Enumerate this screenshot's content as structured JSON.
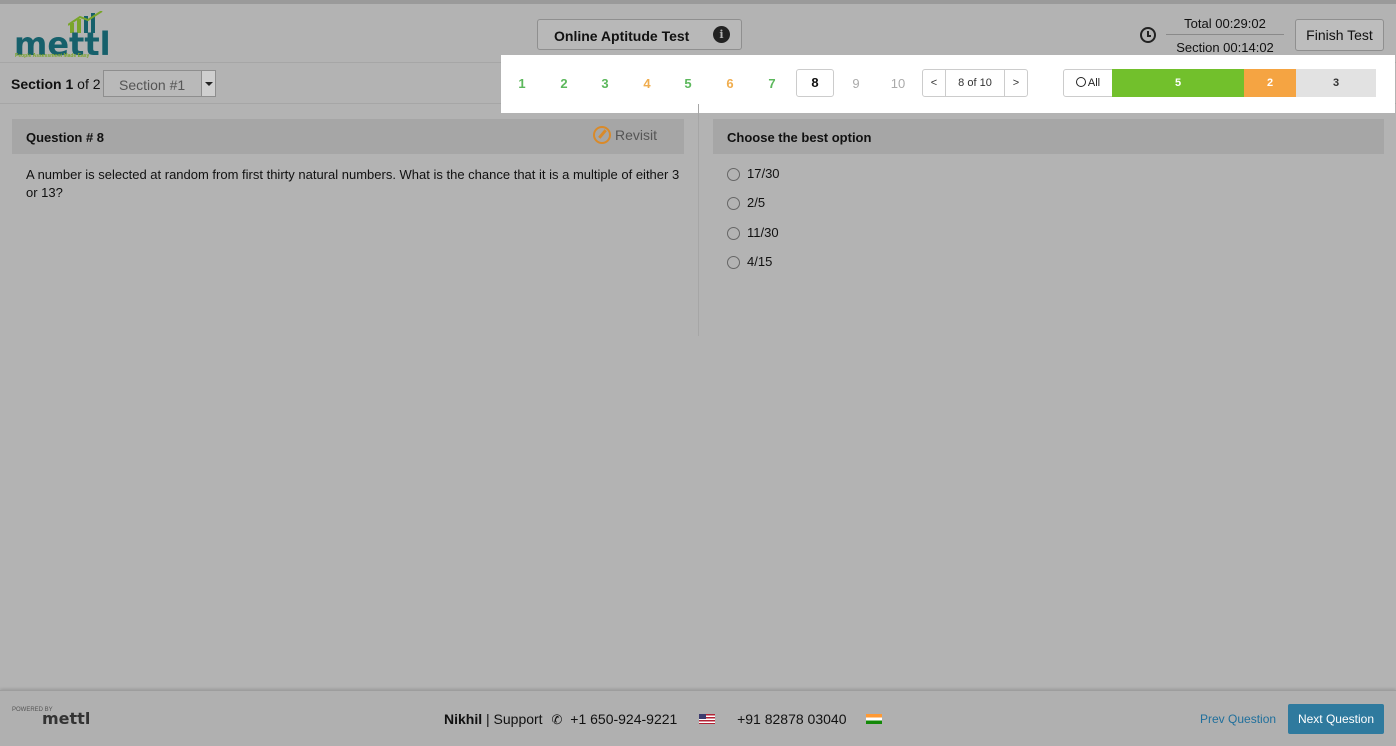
{
  "brand": {
    "logo_word": "mettl",
    "tagline": "People Assessment Made Easy"
  },
  "header": {
    "test_title": "Online Aptitude Test",
    "timer_total": "Total 00:29:02",
    "timer_section": "Section 00:14:02",
    "finish_label": "Finish Test"
  },
  "section": {
    "label_prefix": "Section",
    "number": "1",
    "of_total": "of 2",
    "selected": "Section #1"
  },
  "questions_nav": {
    "numbers": [
      "1",
      "2",
      "3",
      "4",
      "5",
      "6",
      "7",
      "8",
      "9",
      "10"
    ],
    "states": [
      "answered",
      "answered",
      "answered",
      "revisit",
      "answered",
      "revisit",
      "answered",
      "current",
      "unanswered",
      "unanswered"
    ],
    "prev": "<",
    "position": "8 of 10",
    "next": ">",
    "all_label": "All",
    "answered_count": "5",
    "revisit_count": "2",
    "unanswered_count": "3"
  },
  "question": {
    "heading": "Question # 8",
    "revisit_label": "Revisit",
    "text": "A number is selected at random from first thirty natural numbers. What is the chance that it is a multiple of either 3 or 13?"
  },
  "answer": {
    "heading": "Choose the best option",
    "options": [
      "17/30",
      "2/5",
      "11/30",
      "4/15"
    ]
  },
  "footer": {
    "powered_by": "POWERED BY",
    "logo_word": "mettl",
    "user": "Nikhil",
    "support_label": "| Support",
    "phone_us": "+1 650-924-9221",
    "phone_in": "+91 82878 03040",
    "prev_label": "Prev Question",
    "next_label": "Next Question"
  },
  "colors": {
    "answered": "#5cb85c",
    "revisit": "#f0ad4e",
    "accent": "#2f7a9e",
    "brand": "#16606b"
  }
}
